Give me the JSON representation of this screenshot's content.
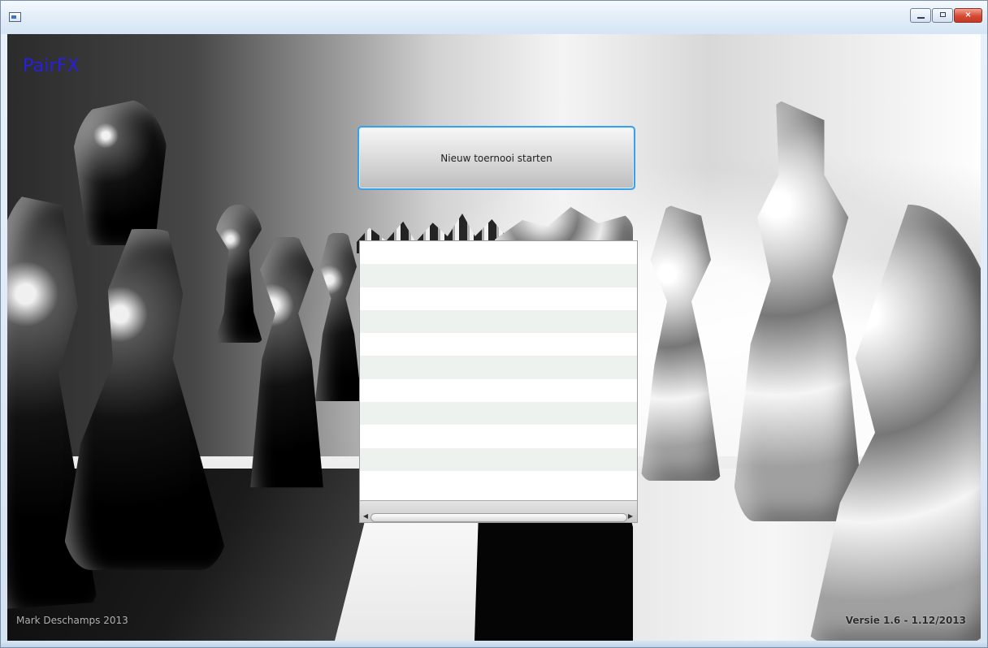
{
  "window": {
    "icon_name": "application-window-icon",
    "controls": {
      "minimize_icon": "minimize-icon",
      "maximize_icon": "maximize-icon",
      "close_icon": "close-icon"
    }
  },
  "app": {
    "title": "PairFX",
    "title_color": "#2a1ee0"
  },
  "actions": {
    "start_tournament_label": "Nieuw toernooi starten"
  },
  "list": {
    "rows": [
      "",
      "",
      "",
      "",
      "",
      "",
      "",
      "",
      "",
      "",
      ""
    ],
    "horizontal_scrollbar": {
      "left_arrow": "◀",
      "right_arrow": "▶"
    }
  },
  "footer": {
    "author_text": "Mark Deschamps 2013",
    "version_text": "Versie 1.6 - 1.12/2013"
  },
  "background": {
    "theme": "chess-board-with-dark-and-light-chess-pieces"
  }
}
